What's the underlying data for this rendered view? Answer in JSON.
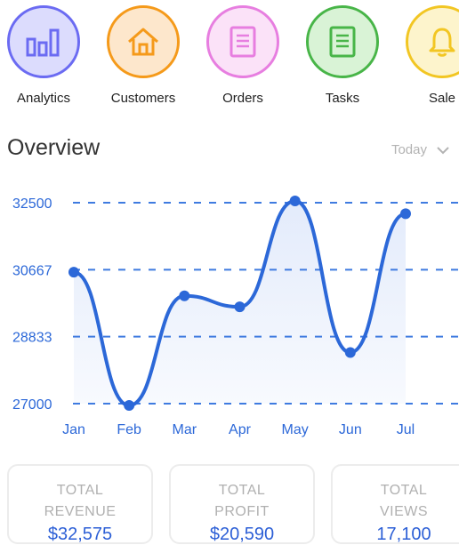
{
  "categories": [
    {
      "label": "Analytics",
      "color": "#6b6bf2",
      "fill": "#dcdcfd",
      "icon": "bar-chart-icon"
    },
    {
      "label": "Customers",
      "color": "#f59a1a",
      "fill": "#fde7cc",
      "icon": "home-icon"
    },
    {
      "label": "Orders",
      "color": "#e77ee0",
      "fill": "#fbe2f8",
      "icon": "document-icon"
    },
    {
      "label": "Tasks",
      "color": "#48b548",
      "fill": "#d9f3d6",
      "icon": "list-icon"
    },
    {
      "label": "Sale",
      "color": "#f2c623",
      "fill": "#fdf4cc",
      "icon": "bell-icon"
    }
  ],
  "overview": {
    "title": "Overview",
    "period": "Today"
  },
  "chart_data": {
    "type": "area",
    "categories": [
      "Jan",
      "Feb",
      "Mar",
      "Apr",
      "May",
      "Jun",
      "Jul"
    ],
    "values": [
      30600,
      26950,
      29950,
      29650,
      32550,
      28400,
      32200
    ],
    "ytick_labels": [
      "32500",
      "30667",
      "28833",
      "27000"
    ],
    "ylim": [
      27000,
      32500
    ],
    "grid": true,
    "line_color": "#2c68d8",
    "fill_color": "#e3ebfb"
  },
  "cards": [
    {
      "label": "TOTAL REVENUE",
      "value": "$32,575"
    },
    {
      "label": "TOTAL PROFIT",
      "value": "$20,590"
    },
    {
      "label": "TOTAL VIEWS",
      "value": "17,100"
    }
  ]
}
